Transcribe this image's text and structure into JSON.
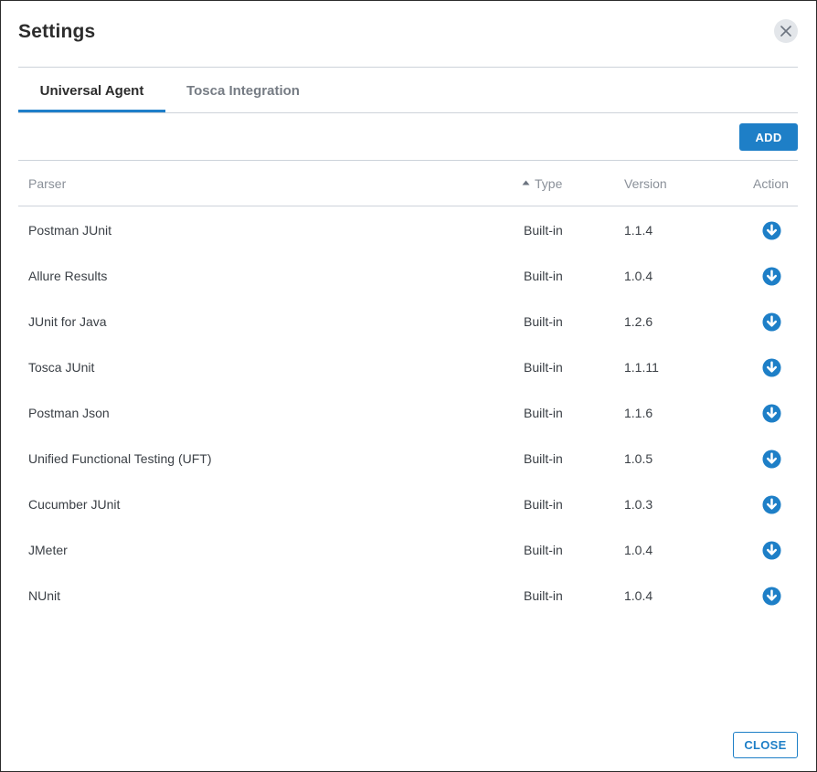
{
  "dialog": {
    "title": "Settings",
    "close_icon": "close-icon"
  },
  "tabs": [
    {
      "label": "Universal Agent",
      "active": true
    },
    {
      "label": "Tosca Integration",
      "active": false
    }
  ],
  "toolbar": {
    "add_label": "ADD"
  },
  "table": {
    "columns": {
      "parser": "Parser",
      "type": "Type",
      "version": "Version",
      "action": "Action"
    },
    "sort_icon": "sort-asc-icon",
    "action_icon": "download-icon",
    "rows": [
      {
        "parser": "Postman JUnit",
        "type": "Built-in",
        "version": "1.1.4"
      },
      {
        "parser": "Allure Results",
        "type": "Built-in",
        "version": "1.0.4"
      },
      {
        "parser": "JUnit for Java",
        "type": "Built-in",
        "version": "1.2.6"
      },
      {
        "parser": "Tosca JUnit",
        "type": "Built-in",
        "version": "1.1.11"
      },
      {
        "parser": "Postman Json",
        "type": "Built-in",
        "version": "1.1.6"
      },
      {
        "parser": "Unified Functional Testing (UFT)",
        "type": "Built-in",
        "version": "1.0.5"
      },
      {
        "parser": "Cucumber JUnit",
        "type": "Built-in",
        "version": "1.0.3"
      },
      {
        "parser": "JMeter",
        "type": "Built-in",
        "version": "1.0.4"
      },
      {
        "parser": "NUnit",
        "type": "Built-in",
        "version": "1.0.4"
      }
    ]
  },
  "footer": {
    "close_label": "CLOSE"
  },
  "colors": {
    "accent": "#1e7fc7",
    "text": "#3a3f45",
    "muted": "#8a9099",
    "divider": "#cdd3da"
  }
}
